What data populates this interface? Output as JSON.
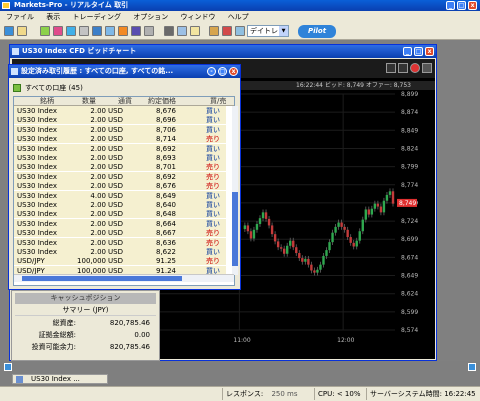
{
  "app": {
    "title": "Markets-Pro - リアルタイム 取引"
  },
  "menu": [
    "ファイル",
    "表示",
    "トレーディング",
    "オプション",
    "ウィンドウ",
    "ヘルプ"
  ],
  "toolbar": {
    "mode_value": "デイトレ",
    "pilot_label": "Pilot"
  },
  "chart_window": {
    "title": "US30 Index CFD ビッドチャート",
    "quote": "16:22:44 ビッド: 8,749 オファー: 8,753"
  },
  "order_window": {
    "title": "設定済み取引履歴 : すべての口座, すべての銘...",
    "account_label": "すべての口座 (45)",
    "columns": [
      "銘柄",
      "数量",
      "通貨",
      "約定価格",
      "買/売"
    ],
    "rows": [
      {
        "sym": "US30 Index",
        "qty": "2.00",
        "ccy": "USD",
        "price": "8,676",
        "side": "買い",
        "type": "buy"
      },
      {
        "sym": "US30 Index",
        "qty": "2.00",
        "ccy": "USD",
        "price": "8,696",
        "side": "買い",
        "type": "buy"
      },
      {
        "sym": "US30 Index",
        "qty": "2.00",
        "ccy": "USD",
        "price": "8,706",
        "side": "買い",
        "type": "buy"
      },
      {
        "sym": "US30 Index",
        "qty": "2.00",
        "ccy": "USD",
        "price": "8,714",
        "side": "売り",
        "type": "sell"
      },
      {
        "sym": "US30 Index",
        "qty": "2.00",
        "ccy": "USD",
        "price": "8,692",
        "side": "買い",
        "type": "buy"
      },
      {
        "sym": "US30 Index",
        "qty": "2.00",
        "ccy": "USD",
        "price": "8,693",
        "side": "買い",
        "type": "buy"
      },
      {
        "sym": "US30 Index",
        "qty": "2.00",
        "ccy": "USD",
        "price": "8,701",
        "side": "売り",
        "type": "sell"
      },
      {
        "sym": "US30 Index",
        "qty": "2.00",
        "ccy": "USD",
        "price": "8,692",
        "side": "売り",
        "type": "sell"
      },
      {
        "sym": "US30 Index",
        "qty": "2.00",
        "ccy": "USD",
        "price": "8,676",
        "side": "売り",
        "type": "sell"
      },
      {
        "sym": "US30 Index",
        "qty": "4.00",
        "ccy": "USD",
        "price": "8,649",
        "side": "買い",
        "type": "buy"
      },
      {
        "sym": "US30 Index",
        "qty": "2.00",
        "ccy": "USD",
        "price": "8,640",
        "side": "買い",
        "type": "buy"
      },
      {
        "sym": "US30 Index",
        "qty": "2.00",
        "ccy": "USD",
        "price": "8,648",
        "side": "買い",
        "type": "buy"
      },
      {
        "sym": "US30 Index",
        "qty": "2.00",
        "ccy": "USD",
        "price": "8,664",
        "side": "買い",
        "type": "buy"
      },
      {
        "sym": "US30 Index",
        "qty": "2.00",
        "ccy": "USD",
        "price": "8,667",
        "side": "売り",
        "type": "sell"
      },
      {
        "sym": "US30 Index",
        "qty": "2.00",
        "ccy": "USD",
        "price": "8,636",
        "side": "売り",
        "type": "sell"
      },
      {
        "sym": "US30 Index",
        "qty": "2.00",
        "ccy": "USD",
        "price": "8,622",
        "side": "買い",
        "type": "buy"
      },
      {
        "sym": "USD/JPY",
        "qty": "100,000",
        "ccy": "USD",
        "price": "91.25",
        "side": "売り",
        "type": "sell"
      },
      {
        "sym": "USD/JPY",
        "qty": "100,000",
        "ccy": "USD",
        "price": "91.24",
        "side": "買い",
        "type": "buy"
      }
    ]
  },
  "cash_window": {
    "header": "キャッシュポジション",
    "summary": "サマリー (JPY)",
    "rows": [
      {
        "label": "総資産:",
        "value": "820,785.46"
      },
      {
        "label": "証拠金総額:",
        "value": "0.00"
      },
      {
        "label": "投資可能余力:",
        "value": "820,785.46"
      }
    ]
  },
  "taskbar": {
    "item": "US30 Index ..."
  },
  "status": {
    "response_label": "レスポンス:",
    "response_value": "250 ms",
    "cpu": "CPU: < 10%",
    "server_time_label": "サーバーシステム時間:",
    "server_time": "16:22:45"
  },
  "chart_data": {
    "type": "line",
    "x_ticks": [
      "11:00",
      "12:00"
    ],
    "y_ticks": [
      "8,574",
      "8,599",
      "8,624",
      "8,649",
      "8,674",
      "8,699",
      "8,724",
      "8,749",
      "8,774",
      "8,799",
      "8,824",
      "8,849",
      "8,874",
      "8,899"
    ],
    "ylim": [
      8574,
      8899
    ],
    "last_price_label": "8,749",
    "series": [
      {
        "values": [
          8713,
          8718,
          8710,
          8700,
          8712,
          8720,
          8728,
          8736,
          8727,
          8718,
          8706,
          8696,
          8688,
          8686,
          8679,
          8690,
          8697,
          8688,
          8680,
          8673,
          8668,
          8672,
          8664,
          8656,
          8653,
          8657,
          8664,
          8676,
          8684,
          8695,
          8708,
          8716,
          8722,
          8716,
          8712,
          8702,
          8694,
          8689,
          8697,
          8710,
          8726,
          8740,
          8733,
          8741,
          8748,
          8744,
          8736,
          8752,
          8760,
          8765,
          8748
        ]
      }
    ]
  }
}
